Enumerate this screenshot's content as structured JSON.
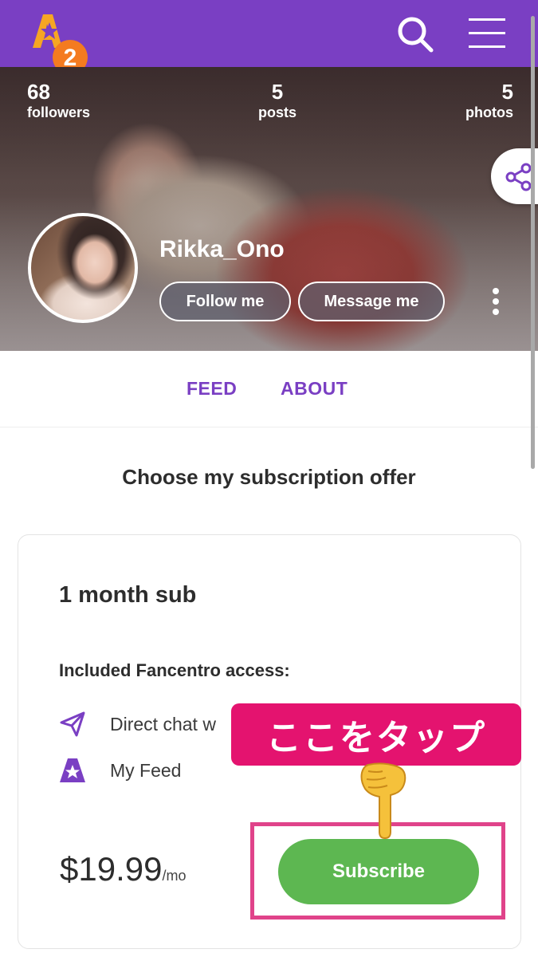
{
  "header": {
    "logo_badge": "2",
    "colors": {
      "bar": "#7a3fc3",
      "logo_star": "#f6a623",
      "logo_badge": "#f47b20"
    }
  },
  "profile": {
    "stats": [
      {
        "value": "68",
        "label": "followers"
      },
      {
        "value": "5",
        "label": "posts"
      },
      {
        "value": "5",
        "label": "photos"
      }
    ],
    "username": "Rikka_Ono",
    "follow_label": "Follow me",
    "message_label": "Message me"
  },
  "tabs": [
    {
      "label": "FEED"
    },
    {
      "label": "ABOUT"
    }
  ],
  "subscription": {
    "section_title": "Choose my subscription offer",
    "plan_name": "1 month sub",
    "access_title": "Included Fancentro access:",
    "features": [
      {
        "icon": "send-icon",
        "label": "Direct chat w"
      },
      {
        "icon": "star-feed-icon",
        "label": "My Feed"
      }
    ],
    "price": "$19.99",
    "price_unit": "/mo",
    "subscribe_label": "Subscribe",
    "colors": {
      "accent": "#7a3fc3",
      "subscribe": "#5db751"
    }
  },
  "annotation": {
    "callout_text": "ここをタップ",
    "pointer_icon": "pointing-down-hand-icon",
    "colors": {
      "callout": "#e4136f",
      "box": "#e0438a"
    }
  }
}
